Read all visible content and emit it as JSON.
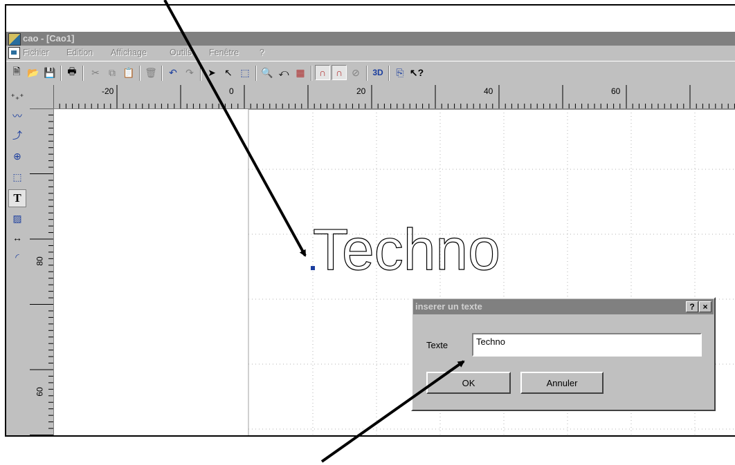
{
  "window": {
    "title": "cao - [Cao1]"
  },
  "menu": [
    "Fichier",
    "Edition",
    "Affichage",
    "Outils",
    "Fenêtre",
    "?"
  ],
  "toolbar": {
    "three_d_label": "3D"
  },
  "rulers": {
    "horizontal": [
      "-20",
      "0",
      "20",
      "40",
      "60"
    ],
    "vertical": [
      "80",
      "60"
    ]
  },
  "canvas": {
    "text": "Techno"
  },
  "dialog": {
    "title": "inserer un texte",
    "help_label": "?",
    "close_label": "×",
    "field_label": "Texte",
    "field_value": "Techno",
    "ok_label": "OK",
    "cancel_label": "Annuler"
  },
  "colors": {
    "titlebar": "#808080",
    "chrome": "#c0c0c0",
    "tool_blue": "#1a3d9e",
    "arrow": "#000000"
  }
}
